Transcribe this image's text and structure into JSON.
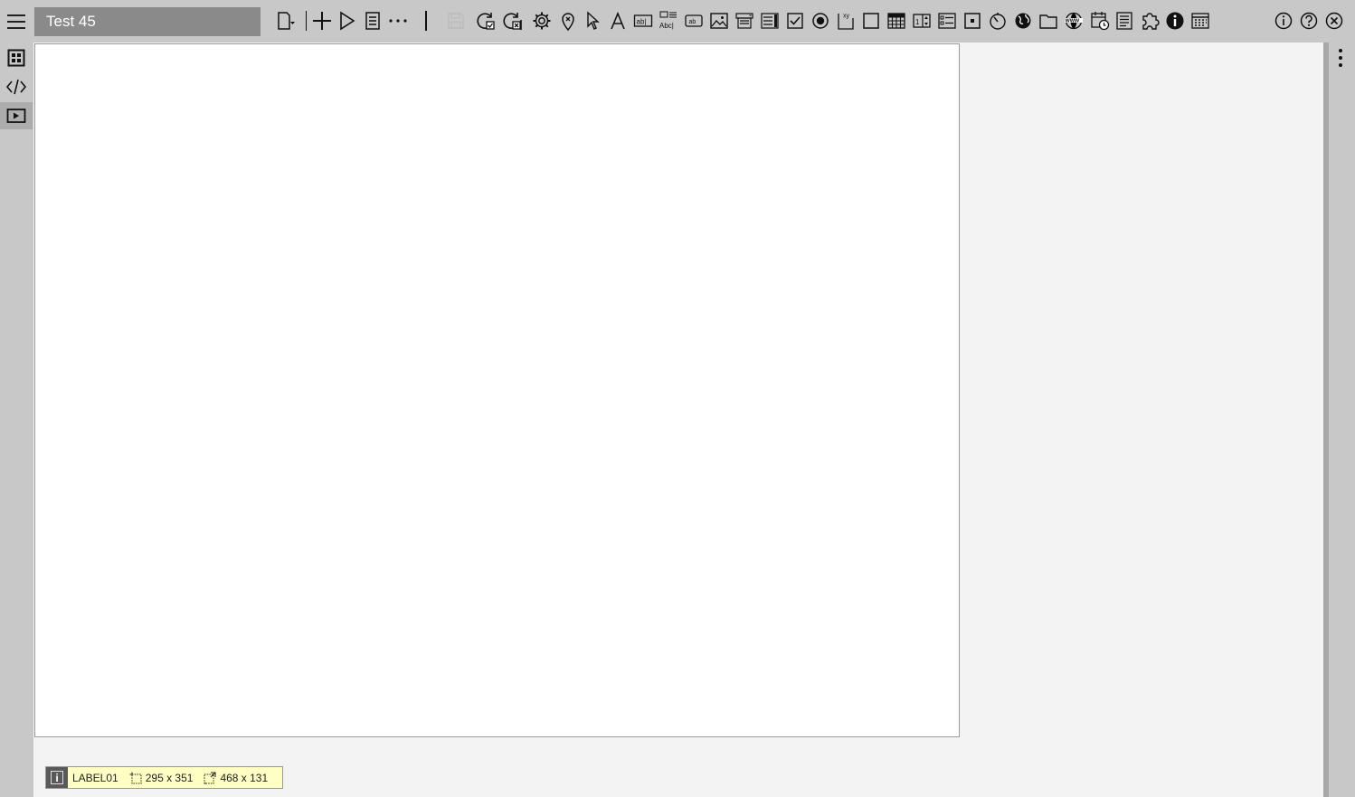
{
  "title": "Test 45",
  "status_bar": {
    "name": "LABEL01",
    "position": "295 x 351",
    "size": "468 x 131"
  },
  "colors": {
    "chrome": "#c8c8c8",
    "title_bg": "#8a8a8a",
    "workspace": "#f3f3f3",
    "canvas": "#ffffff",
    "status_bg": "#ffffc4"
  }
}
